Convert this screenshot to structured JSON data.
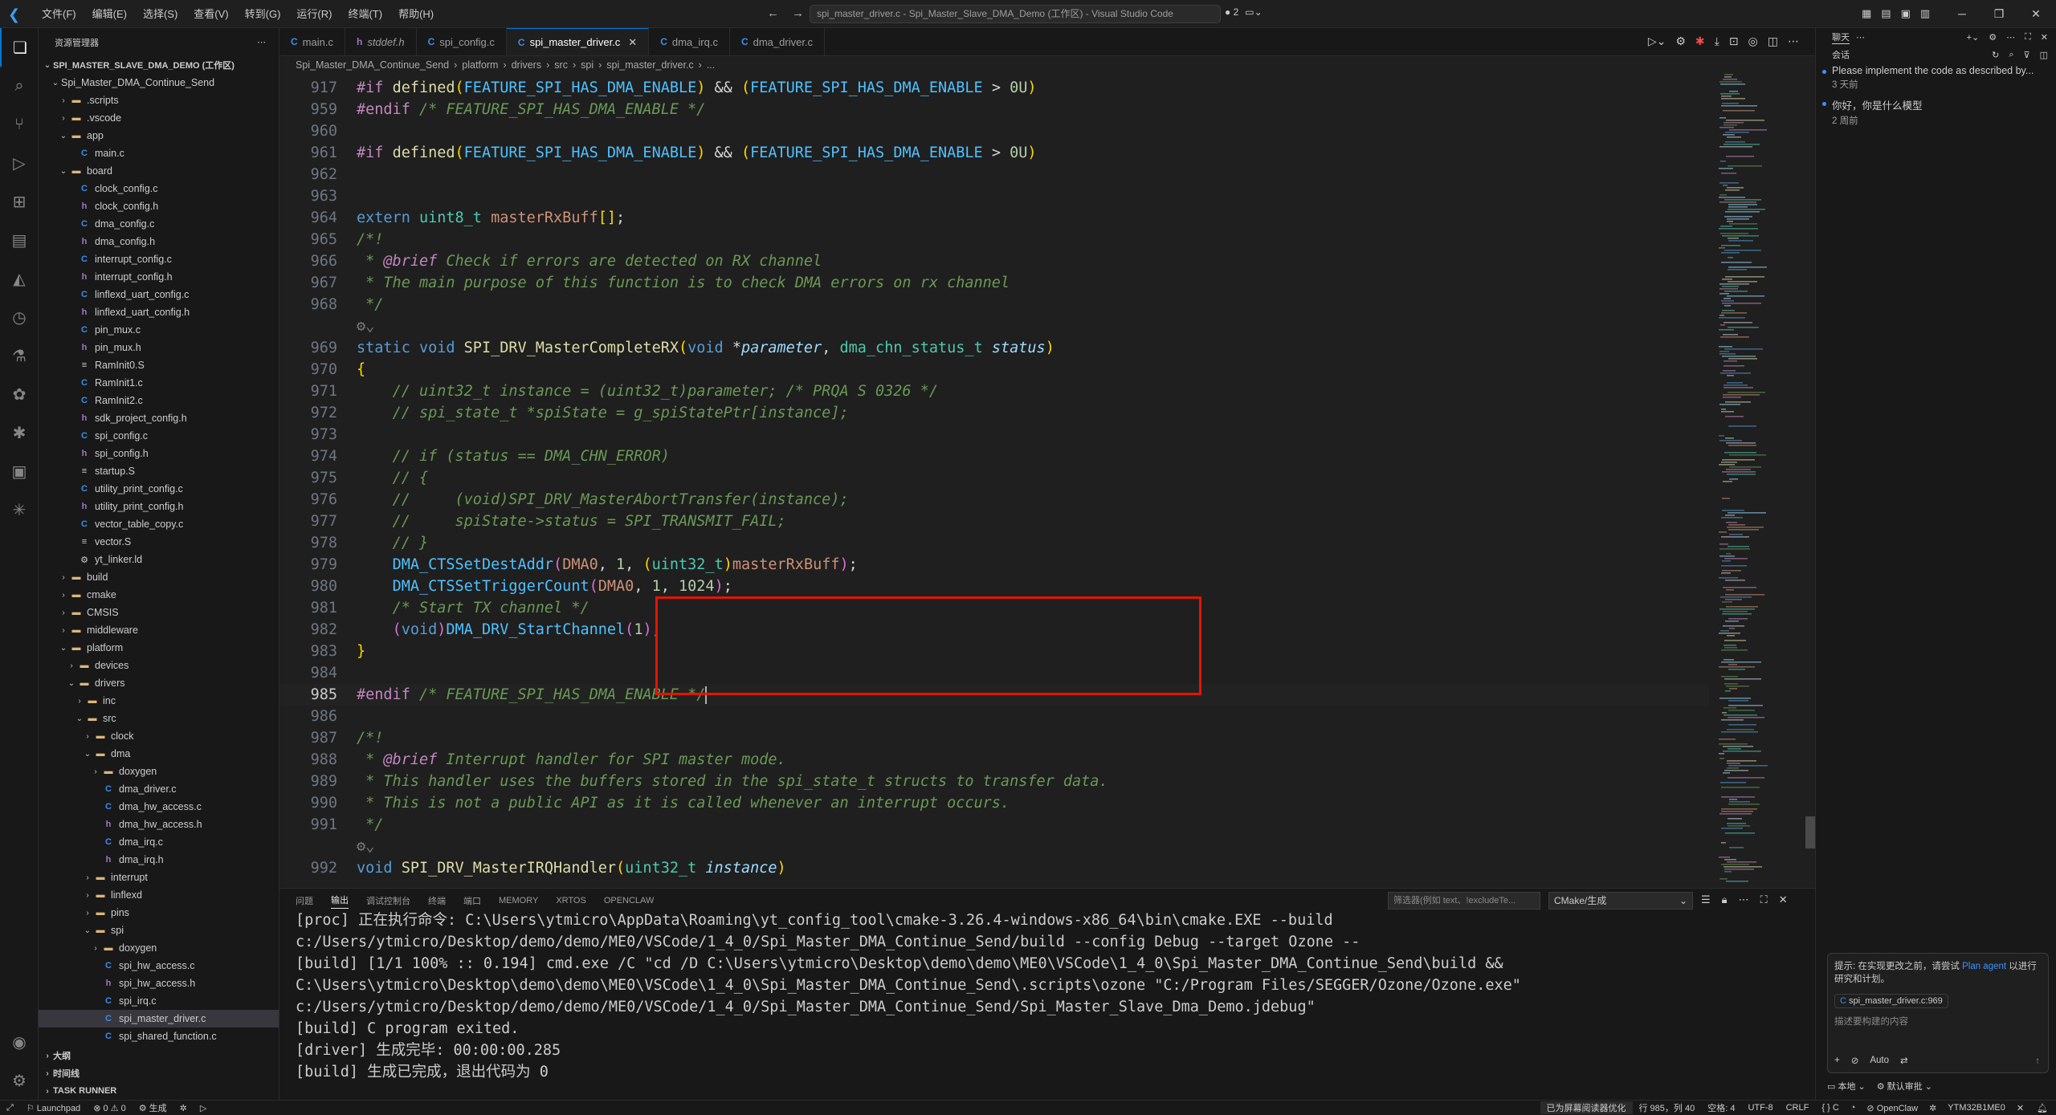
{
  "titlebar": {
    "menu": [
      "文件(F)",
      "编辑(E)",
      "选择(S)",
      "查看(V)",
      "转到(G)",
      "运行(R)",
      "终端(T)",
      "帮助(H)"
    ],
    "search": "spi_master_driver.c - Spi_Master_Slave_DMA_Demo (工作区) - Visual Studio Code",
    "badge": "2"
  },
  "sidebar": {
    "header": "资源管理器",
    "root": "SPI_MASTER_SLAVE_DMA_DEMO (工作区)",
    "items": [
      {
        "d": 1,
        "chev": "v",
        "icon": "",
        "label": "Spi_Master_DMA_Continue_Send"
      },
      {
        "d": 2,
        "chev": ">",
        "icon": "folder",
        "label": ".scripts"
      },
      {
        "d": 2,
        "chev": ">",
        "icon": "folder",
        "label": ".vscode"
      },
      {
        "d": 2,
        "chev": "v",
        "icon": "folder",
        "label": "app"
      },
      {
        "d": 3,
        "chev": "",
        "icon": "c",
        "label": "main.c"
      },
      {
        "d": 2,
        "chev": "v",
        "icon": "folder",
        "label": "board"
      },
      {
        "d": 3,
        "chev": "",
        "icon": "c",
        "label": "clock_config.c"
      },
      {
        "d": 3,
        "chev": "",
        "icon": "h",
        "label": "clock_config.h"
      },
      {
        "d": 3,
        "chev": "",
        "icon": "c",
        "label": "dma_config.c"
      },
      {
        "d": 3,
        "chev": "",
        "icon": "h",
        "label": "dma_config.h"
      },
      {
        "d": 3,
        "chev": "",
        "icon": "c",
        "label": "interrupt_config.c"
      },
      {
        "d": 3,
        "chev": "",
        "icon": "h",
        "label": "interrupt_config.h"
      },
      {
        "d": 3,
        "chev": "",
        "icon": "c",
        "label": "linflexd_uart_config.c"
      },
      {
        "d": 3,
        "chev": "",
        "icon": "h",
        "label": "linflexd_uart_config.h"
      },
      {
        "d": 3,
        "chev": "",
        "icon": "c",
        "label": "pin_mux.c"
      },
      {
        "d": 3,
        "chev": "",
        "icon": "h",
        "label": "pin_mux.h"
      },
      {
        "d": 3,
        "chev": "",
        "icon": "s",
        "label": "RamInit0.S"
      },
      {
        "d": 3,
        "chev": "",
        "icon": "c",
        "label": "RamInit1.c"
      },
      {
        "d": 3,
        "chev": "",
        "icon": "c",
        "label": "RamInit2.c"
      },
      {
        "d": 3,
        "chev": "",
        "icon": "h",
        "label": "sdk_project_config.h"
      },
      {
        "d": 3,
        "chev": "",
        "icon": "c",
        "label": "spi_config.c"
      },
      {
        "d": 3,
        "chev": "",
        "icon": "h",
        "label": "spi_config.h"
      },
      {
        "d": 3,
        "chev": "",
        "icon": "s",
        "label": "startup.S"
      },
      {
        "d": 3,
        "chev": "",
        "icon": "c",
        "label": "utility_print_config.c"
      },
      {
        "d": 3,
        "chev": "",
        "icon": "h",
        "label": "utility_print_config.h"
      },
      {
        "d": 3,
        "chev": "",
        "icon": "c",
        "label": "vector_table_copy.c"
      },
      {
        "d": 3,
        "chev": "",
        "icon": "s",
        "label": "vector.S"
      },
      {
        "d": 3,
        "chev": "",
        "icon": "ld",
        "label": "yt_linker.ld"
      },
      {
        "d": 2,
        "chev": ">",
        "icon": "folder",
        "label": "build"
      },
      {
        "d": 2,
        "chev": ">",
        "icon": "folder",
        "label": "cmake"
      },
      {
        "d": 2,
        "chev": ">",
        "icon": "folder",
        "label": "CMSIS"
      },
      {
        "d": 2,
        "chev": ">",
        "icon": "folder",
        "label": "middleware"
      },
      {
        "d": 2,
        "chev": "v",
        "icon": "folder",
        "label": "platform"
      },
      {
        "d": 3,
        "chev": ">",
        "icon": "folder",
        "label": "devices"
      },
      {
        "d": 3,
        "chev": "v",
        "icon": "folder",
        "label": "drivers"
      },
      {
        "d": 4,
        "chev": ">",
        "icon": "folder",
        "label": "inc"
      },
      {
        "d": 4,
        "chev": "v",
        "icon": "folder",
        "label": "src"
      },
      {
        "d": 5,
        "chev": ">",
        "icon": "folder",
        "label": "clock"
      },
      {
        "d": 5,
        "chev": "v",
        "icon": "folder",
        "label": "dma"
      },
      {
        "d": 6,
        "chev": ">",
        "icon": "folder",
        "label": "doxygen"
      },
      {
        "d": 6,
        "chev": "",
        "icon": "c",
        "label": "dma_driver.c"
      },
      {
        "d": 6,
        "chev": "",
        "icon": "c",
        "label": "dma_hw_access.c"
      },
      {
        "d": 6,
        "chev": "",
        "icon": "h",
        "label": "dma_hw_access.h"
      },
      {
        "d": 6,
        "chev": "",
        "icon": "c",
        "label": "dma_irq.c"
      },
      {
        "d": 6,
        "chev": "",
        "icon": "h",
        "label": "dma_irq.h"
      },
      {
        "d": 5,
        "chev": ">",
        "icon": "folder",
        "label": "interrupt"
      },
      {
        "d": 5,
        "chev": ">",
        "icon": "folder",
        "label": "linflexd"
      },
      {
        "d": 5,
        "chev": ">",
        "icon": "folder",
        "label": "pins"
      },
      {
        "d": 5,
        "chev": "v",
        "icon": "folder",
        "label": "spi"
      },
      {
        "d": 6,
        "chev": ">",
        "icon": "folder",
        "label": "doxygen"
      },
      {
        "d": 6,
        "chev": "",
        "icon": "c",
        "label": "spi_hw_access.c"
      },
      {
        "d": 6,
        "chev": "",
        "icon": "h",
        "label": "spi_hw_access.h"
      },
      {
        "d": 6,
        "chev": "",
        "icon": "c",
        "label": "spi_irq.c"
      },
      {
        "d": 6,
        "chev": "",
        "icon": "c",
        "label": "spi_master_driver.c",
        "sel": true
      },
      {
        "d": 6,
        "chev": "",
        "icon": "c",
        "label": "spi_shared_function.c"
      }
    ],
    "bottom": [
      "大纲",
      "时间线",
      "TASK RUNNER"
    ]
  },
  "tabs": [
    {
      "icon": "c",
      "label": "main.c",
      "active": false,
      "italic": false
    },
    {
      "icon": "h",
      "label": "stddef.h",
      "active": false,
      "italic": true
    },
    {
      "icon": "c",
      "label": "spi_config.c",
      "active": false,
      "italic": false
    },
    {
      "icon": "c",
      "label": "spi_master_driver.c",
      "active": true,
      "italic": false
    },
    {
      "icon": "c",
      "label": "dma_irq.c",
      "active": false,
      "italic": false
    },
    {
      "icon": "c",
      "label": "dma_driver.c",
      "active": false,
      "italic": false
    }
  ],
  "breadcrumb": [
    "Spi_Master_DMA_Continue_Send",
    "platform",
    "drivers",
    "src",
    "spi",
    "spi_master_driver.c",
    "..."
  ],
  "code": [
    {
      "n": "917",
      "h": "<span class='pp'>#if</span> <span class='fn'>defined</span><span class='par'>(</span><span class='m'>FEATURE_SPI_HAS_DMA_ENABLE</span><span class='par'>)</span> <span class='p'>&amp;&amp;</span> <span class='par'>(</span><span class='m'>FEATURE_SPI_HAS_DMA_ENABLE</span> <span class='p'>&gt;</span> <span class='num'>0U</span><span class='par'>)</span>"
    },
    {
      "n": "",
      "h": ""
    },
    {
      "n": "959",
      "h": "<span class='pp'>#endif</span> <span class='cmt'>/* FEATURE_SPI_HAS_DMA_ENABLE */</span>"
    },
    {
      "n": "960",
      "h": ""
    },
    {
      "n": "961",
      "h": "<span class='pp'>#if</span> <span class='fn'>defined</span><span class='par'>(</span><span class='m'>FEATURE_SPI_HAS_DMA_ENABLE</span><span class='par'>)</span> <span class='p'>&amp;&amp;</span> <span class='par'>(</span><span class='m'>FEATURE_SPI_HAS_DMA_ENABLE</span> <span class='p'>&gt;</span> <span class='num'>0U</span><span class='par'>)</span>"
    },
    {
      "n": "962",
      "h": ""
    },
    {
      "n": "963",
      "h": ""
    },
    {
      "n": "964",
      "h": "<span class='k'>extern</span> <span class='ty'>uint8_t</span> <span class='pk'>masterRxBuff</span><span class='par'>[]</span><span class='p'>;</span>"
    },
    {
      "n": "965",
      "h": "<span class='cmt'>/*!</span>"
    },
    {
      "n": "966",
      "h": "<span class='cmt'> * </span><span class='dcm'>@brief</span><span class='cmt'> Check if errors are detected on RX channel</span>"
    },
    {
      "n": "967",
      "h": "<span class='cmt'> * The main purpose of this function is to check DMA errors on rx channel</span>"
    },
    {
      "n": "968",
      "h": "<span class='cmt'> */</span>"
    },
    {
      "n": "",
      "h": "<span class='gr'>⚙⌄</span>"
    },
    {
      "n": "969",
      "h": "<span class='k'>static</span> <span class='k'>void</span> <span class='fn'>SPI_DRV_MasterCompleteRX</span><span class='par'>(</span><span class='k'>void</span> <span class='p'>*</span><span class='v it'>parameter</span><span class='p'>,</span> <span class='ty'>dma_chn_status_t</span> <span class='v it'>status</span><span class='par'>)</span>"
    },
    {
      "n": "970",
      "h": "<span class='par'>{</span>"
    },
    {
      "n": "971",
      "h": "    <span class='cmt'>// uint32_t instance = (uint32_t)parameter; /* PRQA S 0326 */</span>"
    },
    {
      "n": "972",
      "h": "    <span class='cmt'>// spi_state_t *spiState = g_spiStatePtr[instance];</span>"
    },
    {
      "n": "973",
      "h": ""
    },
    {
      "n": "974",
      "h": "    <span class='cmt'>// if (status == DMA_CHN_ERROR)</span>"
    },
    {
      "n": "975",
      "h": "    <span class='cmt'>// {</span>"
    },
    {
      "n": "976",
      "h": "    <span class='cmt'>//     (void)SPI_DRV_MasterAbortTransfer(instance);</span>"
    },
    {
      "n": "977",
      "h": "    <span class='cmt'>//     spiState-&gt;status = SPI_TRANSMIT_FAIL;</span>"
    },
    {
      "n": "978",
      "h": "    <span class='cmt'>// }</span>"
    },
    {
      "n": "979",
      "h": "    <span class='m'>DMA_CTSSetDestAddr</span><span class='par2'>(</span><span class='pk'>DMA0</span><span class='p'>,</span> <span class='num'>1</span><span class='p'>,</span> <span class='par'>(</span><span class='ty'>uint32_t</span><span class='par'>)</span><span class='pk'>masterRxBuff</span><span class='par2'>)</span><span class='p'>;</span>"
    },
    {
      "n": "980",
      "h": "    <span class='m'>DMA_CTSSetTriggerCount</span><span class='par2'>(</span><span class='pk'>DMA0</span><span class='p'>,</span> <span class='num'>1</span><span class='p'>,</span> <span class='num'>1024</span><span class='par2'>)</span><span class='p'>;</span>"
    },
    {
      "n": "981",
      "h": "    <span class='cmt'>/* Start TX channel */</span>"
    },
    {
      "n": "982",
      "h": "    <span class='par2'>(</span><span class='k'>void</span><span class='par2'>)</span><span class='m'>DMA_DRV_StartChannel</span><span class='par2'>(</span><span class='num'>1</span><span class='par2'>)</span><span class='p'>;</span>"
    },
    {
      "n": "983",
      "h": "<span class='par'>}</span>"
    },
    {
      "n": "984",
      "h": ""
    },
    {
      "n": "985",
      "h": "<span class='pp'>#endif</span> <span class='cmt'>/* FEATURE_SPI_HAS_DMA_ENABLE */</span>",
      "cur": true
    },
    {
      "n": "986",
      "h": ""
    },
    {
      "n": "987",
      "h": "<span class='cmt'>/*!</span>"
    },
    {
      "n": "988",
      "h": "<span class='cmt'> * </span><span class='dcm'>@brief</span><span class='cmt'> Interrupt handler for SPI master mode.</span>"
    },
    {
      "n": "989",
      "h": "<span class='cmt'> * This handler uses the buffers stored in the spi_state_t structs to transfer data.</span>"
    },
    {
      "n": "990",
      "h": "<span class='cmt'> * This is not a public API as it is called whenever an interrupt occurs.</span>"
    },
    {
      "n": "991",
      "h": "<span class='cmt'> */</span>"
    },
    {
      "n": "",
      "h": "<span class='gr'>⚙⌄</span>"
    },
    {
      "n": "992",
      "h": "<span class='k'>void</span> <span class='fn'>SPI_DRV_MasterIRQHandler</span><span class='par'>(</span><span class='ty'>uint32_t</span> <span class='v it'>instance</span><span class='par'>)</span>"
    }
  ],
  "panel": {
    "tabs": [
      "问题",
      "输出",
      "调试控制台",
      "终端",
      "端口",
      "MEMORY",
      "XRTOS",
      "OPENCLAW"
    ],
    "active_tab": 1,
    "filter_placeholder": "筛选器(例如 text、!excludeTe...",
    "channel": "CMake/生成",
    "lines": [
      "[proc] 正在执行命令: C:\\Users\\ytmicro\\AppData\\Roaming\\yt_config_tool\\cmake-3.26.4-windows-x86_64\\bin\\cmake.EXE --build",
      "c:/Users/ytmicro/Desktop/demo/demo/ME0/VSCode/1_4_0/Spi_Master_DMA_Continue_Send/build --config Debug --target Ozone --",
      "[build] [1/1 100% :: 0.194] cmd.exe /C \"cd /D C:\\Users\\ytmicro\\Desktop\\demo\\demo\\ME0\\VSCode\\1_4_0\\Spi_Master_DMA_Continue_Send\\build &&",
      "C:\\Users\\ytmicro\\Desktop\\demo\\demo\\ME0\\VSCode\\1_4_0\\Spi_Master_DMA_Continue_Send\\.scripts\\ozone \"C:/Program Files/SEGGER/Ozone/Ozone.exe\"",
      "c:/Users/ytmicro/Desktop/demo/demo/ME0/VSCode/1_4_0/Spi_Master_DMA_Continue_Send/Spi_Master_Slave_Dma_Demo.jdebug\"",
      "[build] C program exited.",
      "[driver] 生成完毕: 00:00:00.285",
      "[build] 生成已完成，退出代码为 0"
    ]
  },
  "chat": {
    "title": "聊天",
    "section": "会话",
    "sessions": [
      {
        "title": "Please implement the code as described by...",
        "time": "3 天前"
      },
      {
        "title": "你好，你是什么模型",
        "time": "2 周前"
      }
    ],
    "hint_prefix": "提示: 在实现更改之前，请尝试 ",
    "hint_link": "Plan agent",
    "hint_suffix": " 以进行研究和计划。",
    "context_file": "spi_master_driver.c:969",
    "input_placeholder": "描述要构建的内容",
    "mode": "Auto",
    "footer_left": "本地",
    "footer_right": "默认审批"
  },
  "status": {
    "remote": "Launchpad",
    "problems": "0",
    "warnings": "0",
    "build": "生成",
    "screen_reader": "已为屏幕阅读器优化",
    "position": "行 985，列 40",
    "spaces": "空格: 4",
    "encoding": "UTF-8",
    "eol": "CRLF",
    "lang": "C",
    "openclaw": "OpenClaw",
    "chip": "YTM32B1ME0"
  }
}
